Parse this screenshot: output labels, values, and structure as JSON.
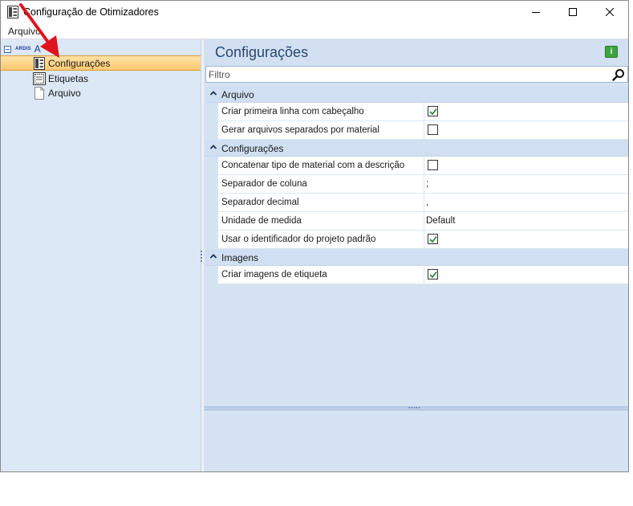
{
  "window": {
    "title": "Configuração de Otimizadores",
    "app_icon": "settings-panel-icon"
  },
  "menu": {
    "items": [
      {
        "label": "Arquivo"
      }
    ]
  },
  "tree": {
    "root": {
      "logo_text": "ARDIS",
      "label": "A"
    },
    "items": [
      {
        "label": "Configurações",
        "icon": "settings-panel-icon",
        "selected": true
      },
      {
        "label": "Etiquetas",
        "icon": "label-icon",
        "selected": false
      },
      {
        "label": "Arquivo",
        "icon": "document-icon",
        "selected": false
      }
    ]
  },
  "panel": {
    "title": "Configurações",
    "filter_placeholder": "Filtro"
  },
  "categories": [
    {
      "label": "Arquivo",
      "properties": [
        {
          "name": "Criar primeira linha com cabeçalho",
          "type": "checkbox",
          "checked": true
        },
        {
          "name": "Gerar arquivos separados por material",
          "type": "checkbox",
          "checked": false
        }
      ]
    },
    {
      "label": "Configurações",
      "properties": [
        {
          "name": "Concatenar tipo de material com a descrição",
          "type": "checkbox",
          "checked": false
        },
        {
          "name": "Separador de coluna",
          "type": "text",
          "value": ";"
        },
        {
          "name": "Separador decimal",
          "type": "text",
          "value": ","
        },
        {
          "name": "Unidade de medida",
          "type": "text",
          "value": "Default"
        },
        {
          "name": "Usar o identificador do projeto padrão",
          "type": "checkbox",
          "checked": true
        }
      ]
    },
    {
      "label": "Imagens",
      "properties": [
        {
          "name": "Criar imagens de etiqueta",
          "type": "checkbox",
          "checked": true
        }
      ]
    }
  ],
  "colors": {
    "selection": "#ffc871",
    "tree_bg": "#dde8f6",
    "panel_bg": "#d6e3f3",
    "check_green": "#2e8b3d",
    "annotation_arrow": "#e0141e"
  }
}
